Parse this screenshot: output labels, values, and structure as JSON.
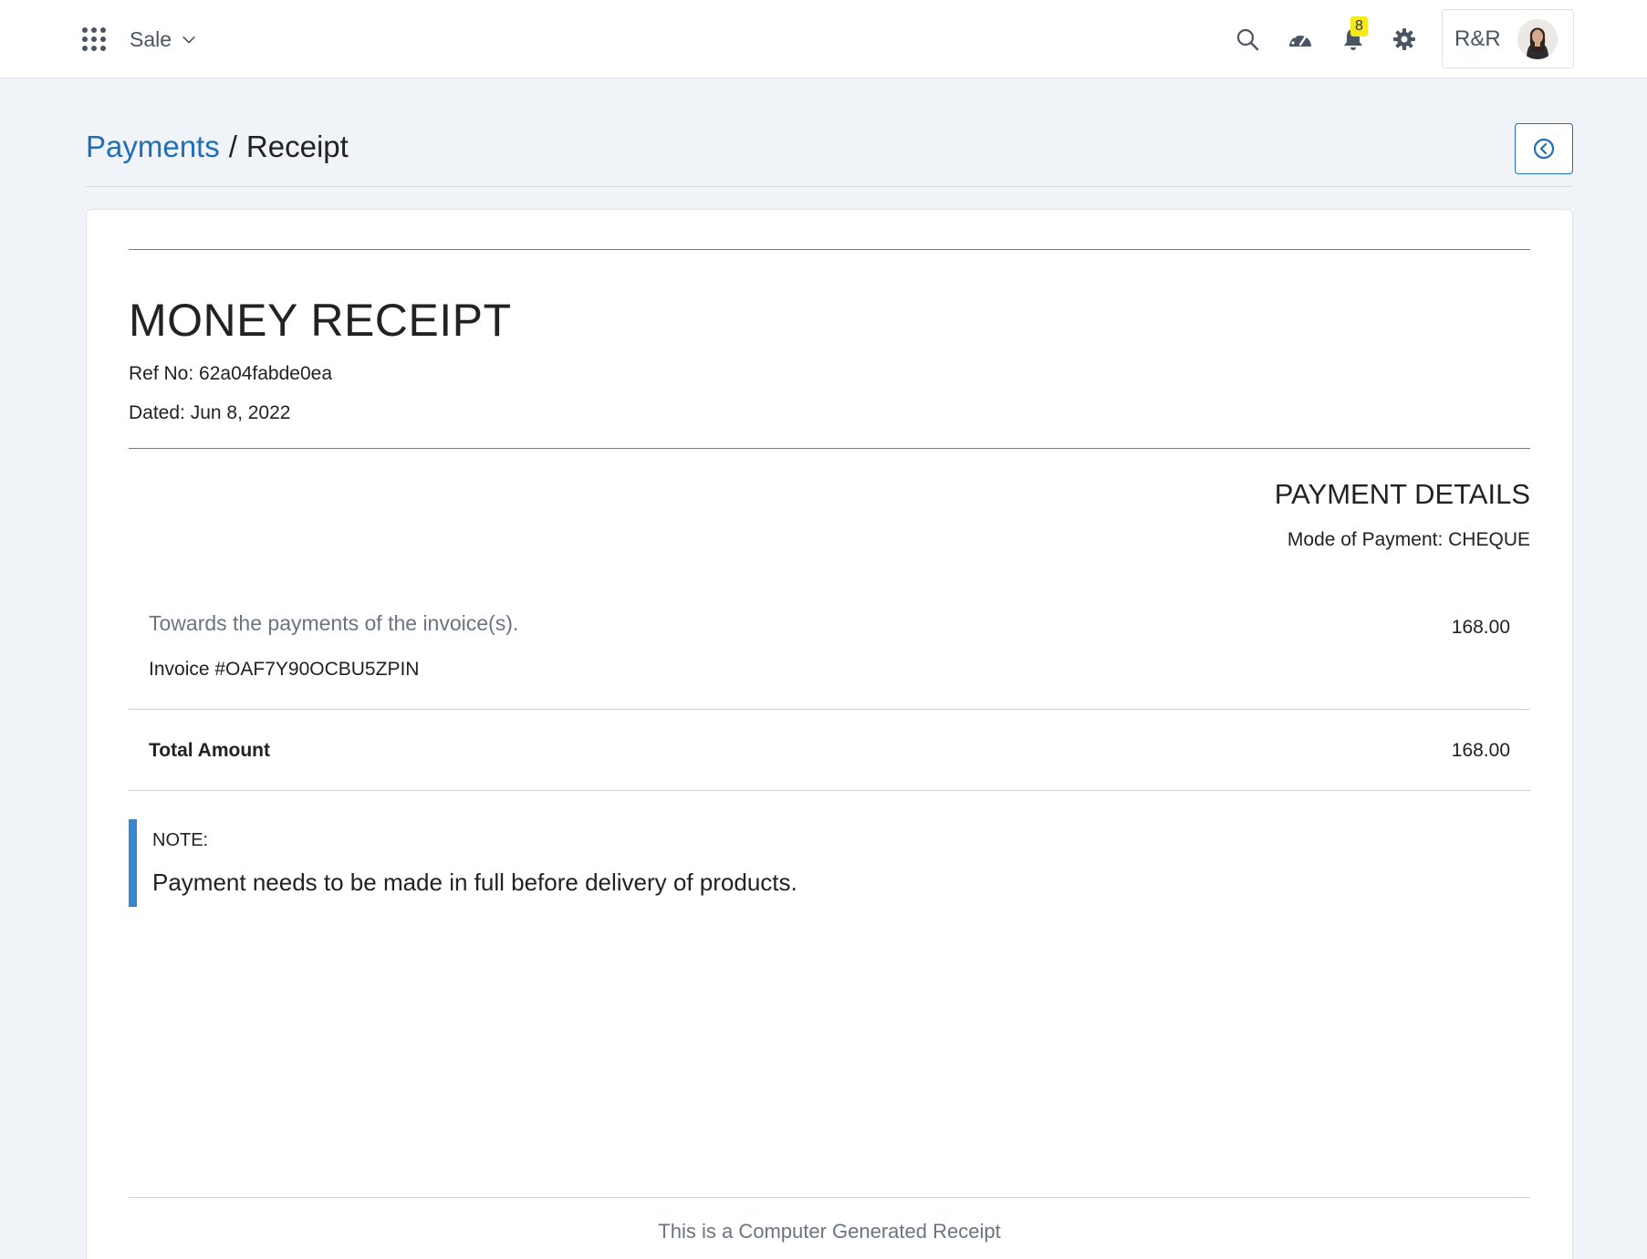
{
  "topbar": {
    "app_name": "Sale",
    "notification_count": "8",
    "user_initials": "R&R",
    "icons": [
      "apps-grid-icon",
      "chevron-down-icon",
      "search-icon",
      "dashboard-gauge-icon",
      "bell-icon",
      "gear-icon",
      "avatar"
    ]
  },
  "breadcrumb": {
    "parent": "Payments",
    "separator": "/",
    "current": "Receipt"
  },
  "receipt": {
    "title": "MONEY RECEIPT",
    "ref_no": "Ref No: 62a04fabde0ea",
    "dated": "Dated: Jun 8, 2022",
    "payment_details_title": "PAYMENT DETAILS",
    "mode_of_payment": "Mode of Payment: CHEQUE",
    "towards_text": "Towards the payments of the invoice(s).",
    "line_amount": "168.00",
    "invoice": "Invoice #OAF7Y90OCBU5ZPIN",
    "total_label": "Total Amount",
    "total_amount": "168.00",
    "note_label": "NOTE:",
    "note_text": "Payment needs to be made in full before delivery of products.",
    "footer": "This is a Computer Generated Receipt"
  },
  "colors": {
    "accent": "#1f6fb8",
    "rule_blue": "#3a86cc",
    "badge": "#f5e81b",
    "background": "#f0f3f8"
  }
}
